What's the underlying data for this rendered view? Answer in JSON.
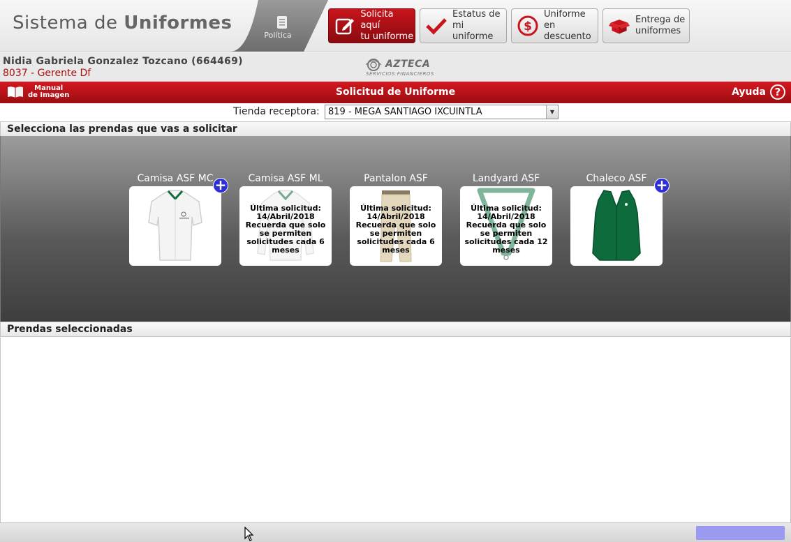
{
  "header": {
    "brand_prefix": "Sistema de",
    "brand_bold": "Uniformes",
    "policy_label": "Política",
    "nav": [
      {
        "label_line1": "Solicita aquí",
        "label_line2": "tu uniforme",
        "icon": "edit-icon"
      },
      {
        "label_line1": "Estatus de",
        "label_line2": "mi uniforme",
        "icon": "checkmark-icon"
      },
      {
        "label_line1": "Uniforme en",
        "label_line2": "descuento",
        "icon": "dollar-icon"
      },
      {
        "label_line1": "Entrega de",
        "label_line2": "uniformes",
        "icon": "box-icon"
      }
    ]
  },
  "user": {
    "name": "Nidia Gabriela Gonzalez Tozcano (664469)",
    "role": "8037 - Gerente Df"
  },
  "logo": {
    "text": "AZTECA",
    "sub": "SERVICIOS FINANCIEROS"
  },
  "redbar": {
    "manual_line1": "Manual",
    "manual_line2": "de Imagen",
    "title": "Solicitud de Uniforme",
    "help_label": "Ayuda",
    "help_symbol": "?"
  },
  "store": {
    "label": "Tienda receptora:",
    "value": "819 - MEGA SANTIAGO IXCUINTLA"
  },
  "sections": {
    "select_title": "Selecciona las prendas que vas a solicitar",
    "selected_title": "Prendas seleccionadas"
  },
  "garments": [
    {
      "name": "Camisa ASF MC",
      "available": true,
      "message": ""
    },
    {
      "name": "Camisa ASF ML",
      "available": false,
      "message": "Última solicitud: 14/Abril/2018 Recuerda que solo se permiten solicitudes cada 6 meses"
    },
    {
      "name": "Pantalon ASF",
      "available": false,
      "message": "Última solicitud: 14/Abril/2018 Recuerda que solo se permiten solicitudes cada 6 meses"
    },
    {
      "name": "Landyard ASF",
      "available": false,
      "message": "Última solicitud: 14/Abril/2018 Recuerda que solo se permiten solicitudes cada 12 meses"
    },
    {
      "name": "Chaleco ASF",
      "available": true,
      "message": ""
    }
  ],
  "add_symbol": "+",
  "colors": {
    "brand_red": "#c9141c",
    "add_blue": "#2f2fd8",
    "vest_green": "#0d6b3c"
  }
}
